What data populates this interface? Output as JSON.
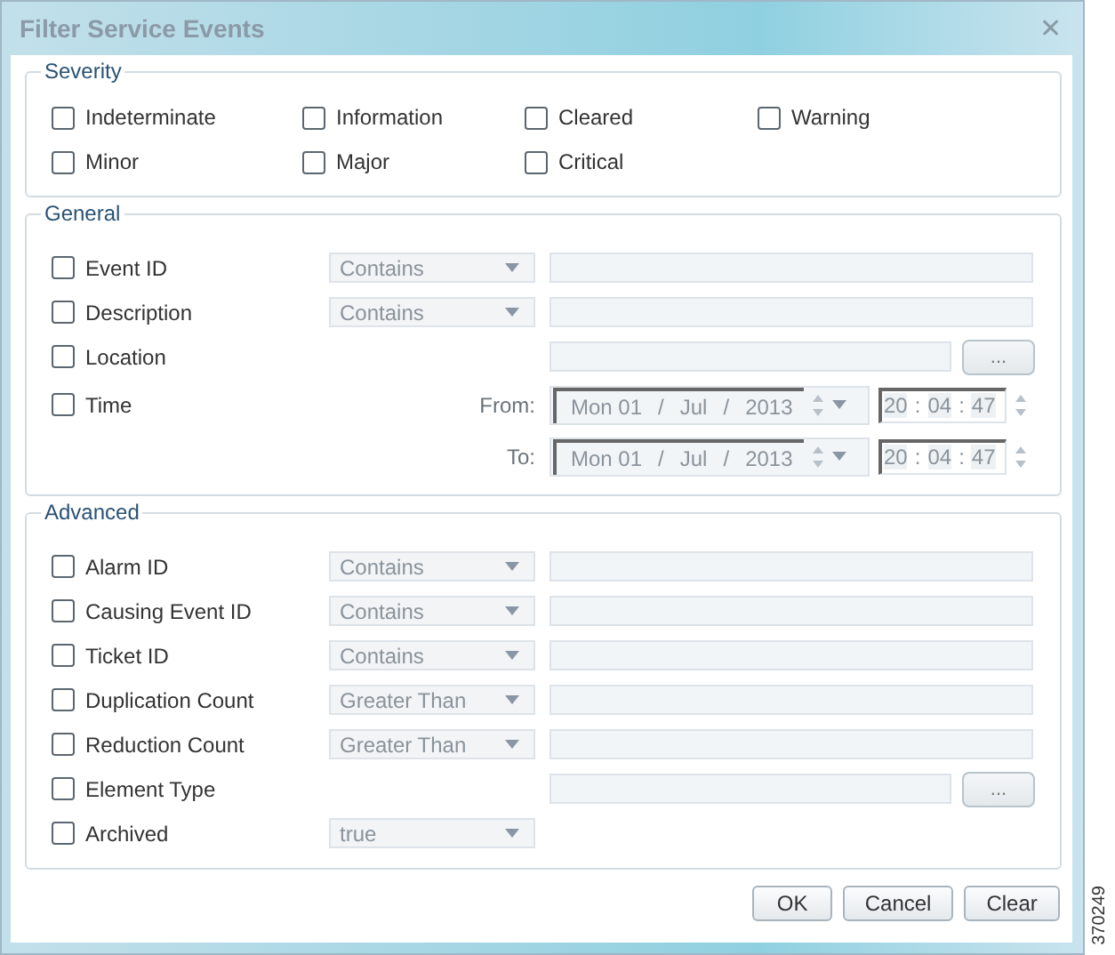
{
  "window": {
    "title": "Filter Service Events",
    "close": "✕"
  },
  "severity": {
    "title": "Severity",
    "options": [
      {
        "label": "Indeterminate",
        "checked": false
      },
      {
        "label": "Information",
        "checked": false
      },
      {
        "label": "Cleared",
        "checked": false
      },
      {
        "label": "Warning",
        "checked": false
      },
      {
        "label": "Minor",
        "checked": false
      },
      {
        "label": "Major",
        "checked": false
      },
      {
        "label": "Critical",
        "checked": false
      }
    ]
  },
  "general": {
    "title": "General",
    "rows": [
      {
        "kind": "match",
        "label": "Event ID",
        "checked": false,
        "operator": "Contains"
      },
      {
        "kind": "match",
        "label": "Description",
        "checked": false,
        "operator": "Contains"
      },
      {
        "kind": "browse",
        "label": "Location",
        "checked": false,
        "button": "..."
      },
      {
        "kind": "time",
        "label": "Time",
        "checked": false,
        "ranges": [
          {
            "label": "From:",
            "date": [
              "Mon 01",
              "/",
              "Jul",
              "/",
              "2013"
            ],
            "time": [
              "20",
              ":",
              "04",
              ":",
              "47"
            ]
          },
          {
            "label": "To:",
            "date": [
              "Mon 01",
              "/",
              "Jul",
              "/",
              "2013"
            ],
            "time": [
              "20",
              ":",
              "04",
              ":",
              "47"
            ]
          }
        ]
      }
    ]
  },
  "advanced": {
    "title": "Advanced",
    "rows": [
      {
        "kind": "match",
        "label": "Alarm ID",
        "checked": false,
        "operator": "Contains"
      },
      {
        "kind": "match",
        "label": "Causing Event ID",
        "checked": false,
        "operator": "Contains"
      },
      {
        "kind": "match",
        "label": "Ticket ID",
        "checked": false,
        "operator": "Contains"
      },
      {
        "kind": "match",
        "label": "Duplication Count",
        "checked": false,
        "operator": "Greater Than"
      },
      {
        "kind": "match",
        "label": "Reduction Count",
        "checked": false,
        "operator": "Greater Than"
      },
      {
        "kind": "browse",
        "label": "Element Type",
        "checked": false,
        "button": "..."
      },
      {
        "kind": "select",
        "label": "Archived",
        "checked": false,
        "operator": "true"
      }
    ]
  },
  "buttons": [
    "OK",
    "Cancel",
    "Clear"
  ],
  "figure_id": "370249"
}
